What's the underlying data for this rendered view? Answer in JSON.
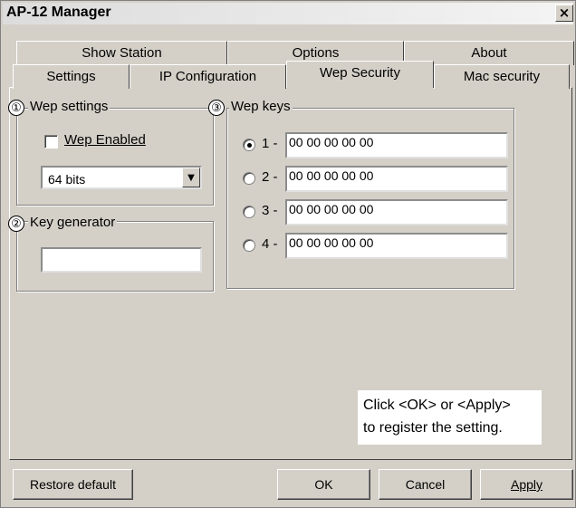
{
  "window": {
    "title": "AP-12 Manager",
    "close_glyph": "×"
  },
  "tabs": {
    "row1": [
      "Show Station",
      "Options",
      "About"
    ],
    "row2": [
      "Settings",
      "IP Configuration",
      "Wep Security",
      "Mac security"
    ],
    "active": "Wep Security"
  },
  "wep_settings": {
    "marker": "①",
    "legend": "Wep settings",
    "checkbox_label": "Wep Enabled",
    "checked": false,
    "key_length": "64 bits"
  },
  "key_generator": {
    "marker": "②",
    "legend": "Key generator",
    "value": ""
  },
  "wep_keys": {
    "marker": "③",
    "legend": "Wep keys",
    "selected": 1,
    "items": [
      {
        "label": "1 -",
        "value": "00 00 00 00 00"
      },
      {
        "label": "2 -",
        "value": "00 00 00 00 00"
      },
      {
        "label": "3 -",
        "value": "00 00 00 00 00"
      },
      {
        "label": "4 -",
        "value": "00 00 00 00 00"
      }
    ]
  },
  "note": {
    "line1": "Click <OK> or <Apply>",
    "line2": "to register the setting."
  },
  "buttons": {
    "restore": "Restore default",
    "ok": "OK",
    "cancel": "Cancel",
    "apply": "Apply"
  }
}
